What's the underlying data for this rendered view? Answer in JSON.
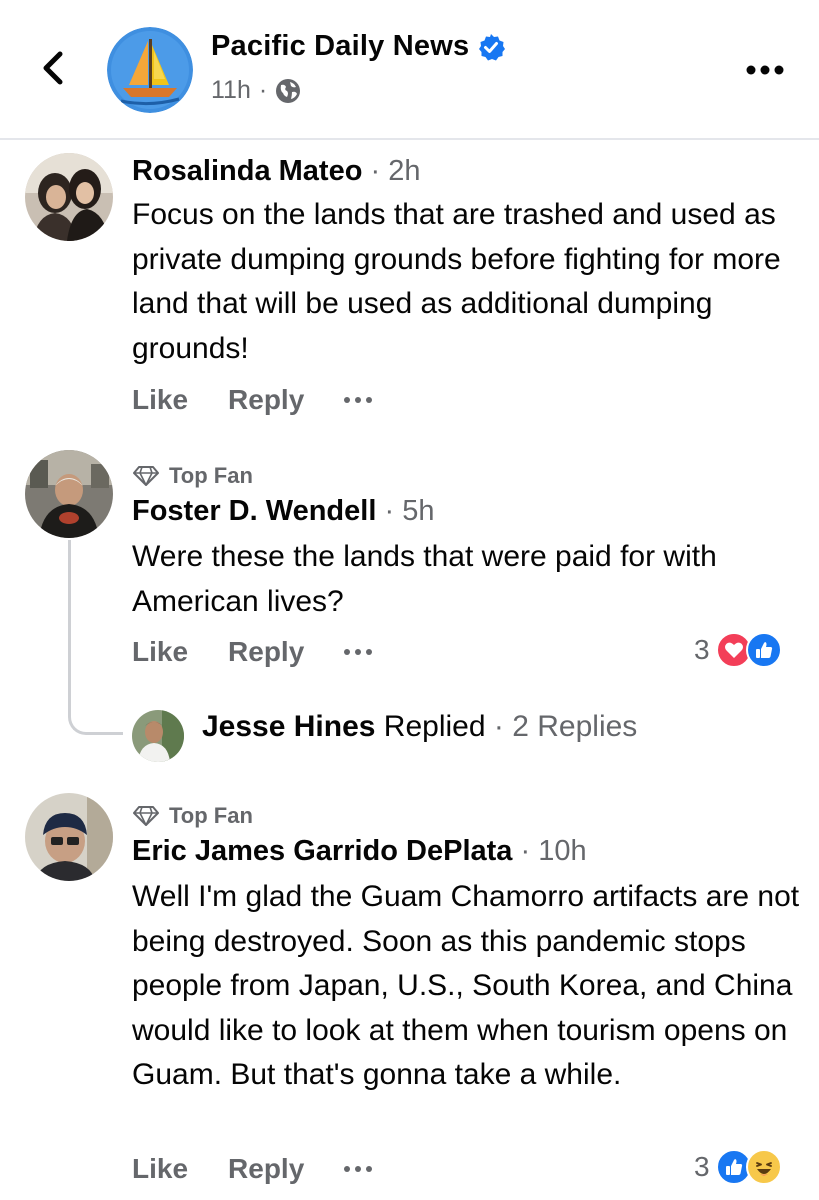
{
  "header": {
    "page_name": "Pacific Daily News",
    "time": "11h",
    "separator": "·",
    "icons": {
      "back": "chevron-left-icon",
      "verified": "verified-badge-icon",
      "audience": "globe-icon",
      "more": "more-options-icon"
    }
  },
  "colors": {
    "facebook_blue": "#1877f2",
    "love_red": "#f33e58",
    "secondary_text": "#65676b",
    "thread_line": "#ced0d4"
  },
  "comments": [
    {
      "name": "Rosalinda Mateo",
      "time": "2h",
      "separator": "·",
      "body": "Focus on the lands that are trashed and used as private dumping grounds before fighting for more land that will be used as additional dumping grounds!",
      "like": "Like",
      "reply": "Reply"
    },
    {
      "badge": "Top Fan",
      "name": "Foster D. Wendell",
      "time": "5h",
      "separator": "·",
      "body": "Were these the lands that were paid for with American lives?",
      "like": "Like",
      "reply": "Reply",
      "reaction_count": "3",
      "reactions": [
        "love-reaction-icon",
        "like-reaction-icon"
      ],
      "reply_summary": {
        "name": "Jesse Hines",
        "action": "Replied",
        "separator": "·",
        "count": "2 Replies"
      }
    },
    {
      "badge": "Top Fan",
      "name": "Eric James Garrido DePlata",
      "time": "10h",
      "separator": "·",
      "body": "Well I'm glad the Guam Chamorro artifacts are not being destroyed. Soon as this pandemic stops people from Japan, U.S., South Korea, and China would like to look at them when tourism opens on Guam. But that's gonna take a while.",
      "like": "Like",
      "reply": "Reply",
      "reaction_count": "3",
      "reactions": [
        "like-reaction-icon",
        "haha-reaction-icon"
      ]
    }
  ]
}
